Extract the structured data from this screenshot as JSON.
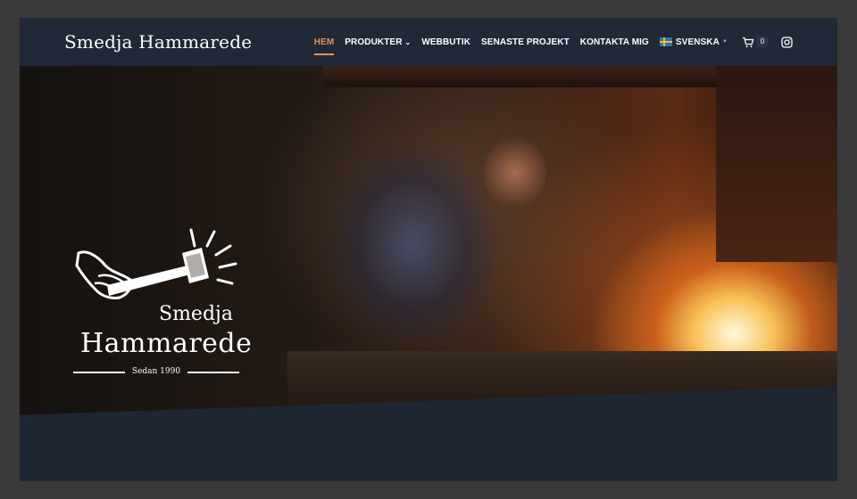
{
  "header": {
    "brand": "Smedja Hammarede",
    "nav": [
      {
        "label": "HEM",
        "active": true
      },
      {
        "label": "PRODUKTER",
        "has_dropdown": true
      },
      {
        "label": "WEBBUTIK"
      },
      {
        "label": "SENASTE PROJEKT"
      },
      {
        "label": "KONTAKTA MIG"
      }
    ],
    "language": "SVENSKA",
    "cart_count": "0",
    "icons": {
      "cart": "cart-icon",
      "instagram": "instagram-icon",
      "flag": "swedish-flag-icon",
      "dropdown": "chevron-down-icon"
    }
  },
  "hero": {
    "logo_word1": "Smedja",
    "logo_word2": "Hammarede",
    "logo_tagline": "Sedan 1990"
  },
  "colors": {
    "header_bg": "#212838",
    "accent": "#e2905a",
    "page_bg": "#1f2633",
    "outer_bg": "#3a3a3a"
  }
}
